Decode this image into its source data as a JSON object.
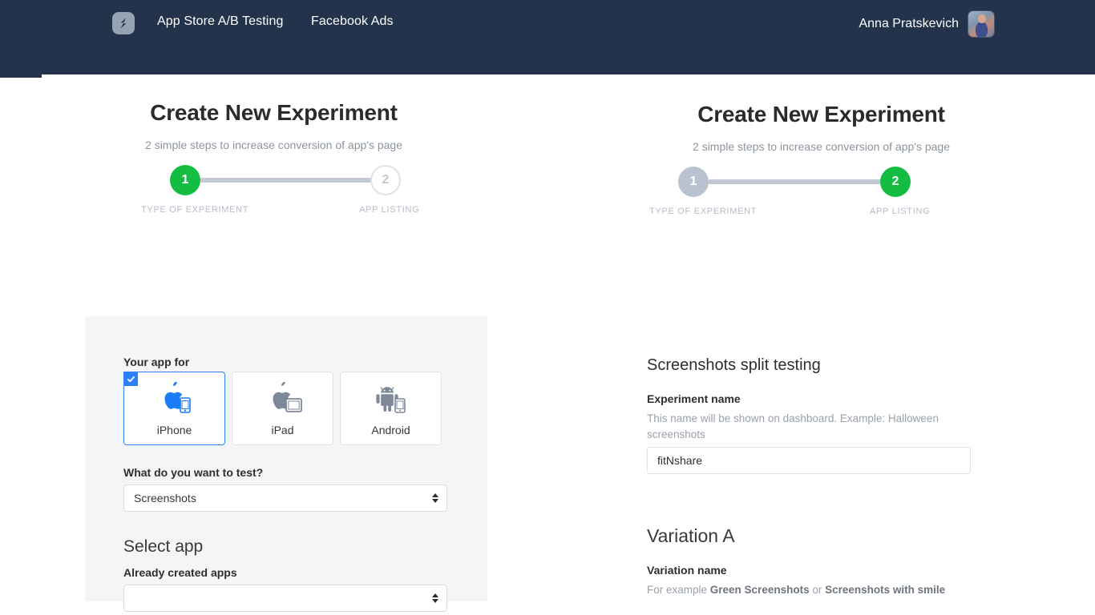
{
  "nav": {
    "logo_icon": "lightning-logo-icon",
    "links": [
      {
        "label": "App Store A/B Testing"
      },
      {
        "label": "Facebook Ads"
      }
    ],
    "user": {
      "name": "Anna Pratskevich",
      "avatar_icon": "user-avatar"
    }
  },
  "colors": {
    "nav_background": "#22334b",
    "step_active": "#14bd41",
    "step_done": "#b9c2cf",
    "accent_variation": "#f8685e",
    "selected_border": "#2d7ff9",
    "card_background": "#f4f5f7"
  },
  "left_panel": {
    "title": "Create New Experiment",
    "subtitle": "2 simple steps to increase conversion of app's page",
    "stepper": {
      "steps": [
        {
          "number": "1",
          "label": "TYPE OF EXPERIMENT",
          "state": "active"
        },
        {
          "number": "2",
          "label": "APP LISTING",
          "state": "idle"
        }
      ]
    },
    "form": {
      "your_app_for_label": "Your app for",
      "devices": [
        {
          "name": "iPhone",
          "icon": "apple-iphone-icon",
          "selected": true
        },
        {
          "name": "iPad",
          "icon": "apple-ipad-icon",
          "selected": false
        },
        {
          "name": "Android",
          "icon": "android-icon",
          "selected": false
        }
      ],
      "test_question_label": "What do you want to test?",
      "test_type_value": "Screenshots",
      "select_app_heading": "Select app",
      "already_created_label": "Already created apps",
      "already_created_value": ""
    }
  },
  "right_panel": {
    "title": "Create New Experiment",
    "subtitle": "2 simple steps to increase conversion of app's page",
    "stepper": {
      "steps": [
        {
          "number": "1",
          "label": "TYPE OF EXPERIMENT",
          "state": "done"
        },
        {
          "number": "2",
          "label": "APP LISTING",
          "state": "active"
        }
      ]
    },
    "form": {
      "heading": "Screenshots split testing",
      "experiment_name_label": "Experiment name",
      "experiment_name_help": "This name will be shown on dashboard. Example: Halloween screenshots",
      "experiment_name_value": "fitNshare",
      "variation_heading": "Variation A",
      "variation_name_label": "Variation name",
      "variation_help_prefix": "For example ",
      "variation_help_bold1": "Green Screenshots",
      "variation_help_mid": " or ",
      "variation_help_bold2": "Screenshots with smile"
    }
  }
}
